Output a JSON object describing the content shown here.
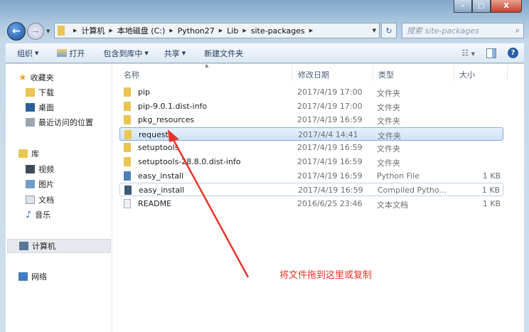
{
  "window": {
    "caption": {
      "minimize": "–",
      "maximize": "□",
      "close": "X"
    }
  },
  "address": {
    "crumbs": [
      "计算机",
      "本地磁盘 (C:)",
      "Python27",
      "Lib",
      "site-packages"
    ]
  },
  "search": {
    "placeholder": "搜索 site-packages"
  },
  "toolbar": {
    "organize": "组织",
    "open": "打开",
    "include_library": "包含到库中",
    "share": "共享",
    "new_folder": "新建文件夹"
  },
  "sidebar": {
    "favorites": "收藏夹",
    "downloads": "下载",
    "desktop": "桌面",
    "recent": "最近访问的位置",
    "libraries": "库",
    "videos": "视频",
    "pictures": "图片",
    "documents": "文档",
    "music": "音乐",
    "computer": "计算机",
    "network": "网络"
  },
  "columns": {
    "name": "名称",
    "modified": "修改日期",
    "type": "类型",
    "size": "大小"
  },
  "files": [
    {
      "name": "pip",
      "modified": "2017/4/19 17:00",
      "type": "文件夹",
      "size": "",
      "icon": "folder"
    },
    {
      "name": "pip-9.0.1.dist-info",
      "modified": "2017/4/19 17:00",
      "type": "文件夹",
      "size": "",
      "icon": "folder"
    },
    {
      "name": "pkg_resources",
      "modified": "2017/4/19 16:59",
      "type": "文件夹",
      "size": "",
      "icon": "folder"
    },
    {
      "name": "requests",
      "modified": "2017/4/4 14:41",
      "type": "文件夹",
      "size": "",
      "icon": "folder"
    },
    {
      "name": "setuptools",
      "modified": "2017/4/19 16:59",
      "type": "文件夹",
      "size": "",
      "icon": "folder"
    },
    {
      "name": "setuptools-28.8.0.dist-info",
      "modified": "2017/4/19 16:59",
      "type": "文件夹",
      "size": "",
      "icon": "folder"
    },
    {
      "name": "easy_install",
      "modified": "2017/4/19 16:59",
      "type": "Python File",
      "size": "1 KB",
      "icon": "python"
    },
    {
      "name": "easy_install",
      "modified": "2017/4/19 16:59",
      "type": "Compiled Pytho...",
      "size": "1 KB",
      "icon": "pyc"
    },
    {
      "name": "README",
      "modified": "2016/6/25 23:46",
      "type": "文本文档",
      "size": "1 KB",
      "icon": "text"
    }
  ],
  "annotation": {
    "text": "将文件拖到这里或复制",
    "color": "#e8342a"
  }
}
